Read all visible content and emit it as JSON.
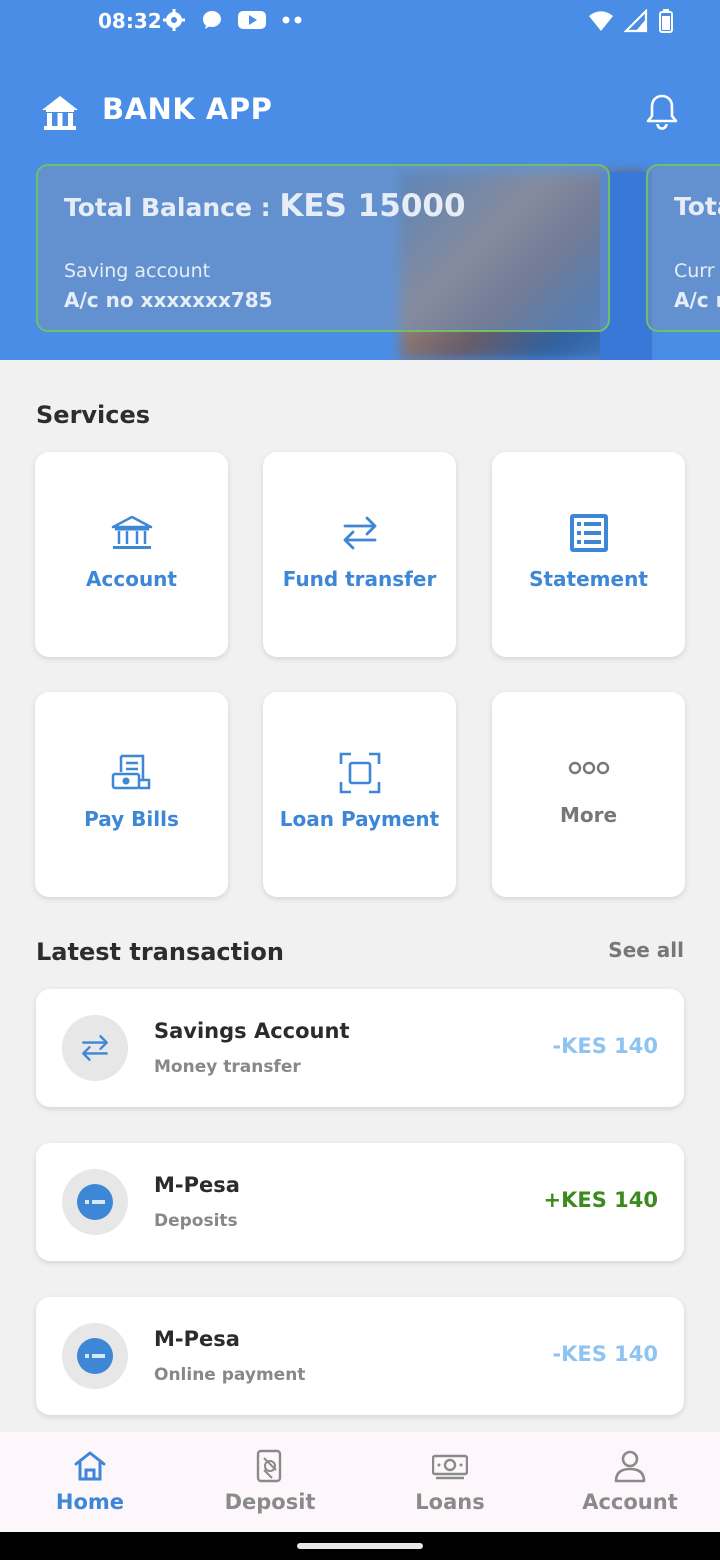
{
  "status_bar": {
    "time": "08:32",
    "icons": [
      "gear-icon",
      "chat-icon",
      "youtube-icon",
      "dots-icon",
      "wifi-icon",
      "signal-icon",
      "battery-icon"
    ]
  },
  "app_bar": {
    "title": "BANK APP",
    "logo_icon": "bank-home-icon",
    "bell_icon": "bell-icon"
  },
  "balance_cards": [
    {
      "balance_label": "Total Balance : ",
      "balance_value": "KES 15000",
      "account_type": "Saving account",
      "account_no": "A/c no xxxxxxx785"
    },
    {
      "balance_label": "Tota",
      "account_type": "Curr",
      "account_no": "A/c n"
    }
  ],
  "services": {
    "title": "Services",
    "items": [
      {
        "label": "Account",
        "icon": "bank-icon"
      },
      {
        "label": "Fund transfer",
        "icon": "transfer-icon"
      },
      {
        "label": "Statement",
        "icon": "statement-icon"
      },
      {
        "label": "Pay Bills",
        "icon": "bill-icon"
      },
      {
        "label": "Loan Payment",
        "icon": "scan-icon"
      },
      {
        "label": "More",
        "icon": "more-icon"
      }
    ]
  },
  "transactions": {
    "title": "Latest transaction",
    "see_all": "See all",
    "items": [
      {
        "title": "Savings Account",
        "subtitle": "Money transfer",
        "amount": "-KES 140",
        "icon": "transfer-icon"
      },
      {
        "title": "M-Pesa",
        "subtitle": "Deposits",
        "amount": "+KES 140",
        "icon": "mpesa-icon"
      },
      {
        "title": "M-Pesa",
        "subtitle": "Online payment",
        "amount": "-KES 140",
        "icon": "mpesa-icon"
      }
    ]
  },
  "bottom_nav": {
    "items": [
      {
        "label": "Home",
        "icon": "home-icon",
        "active": true
      },
      {
        "label": "Deposit",
        "icon": "deposit-icon",
        "active": false
      },
      {
        "label": "Loans",
        "icon": "cash-icon",
        "active": false
      },
      {
        "label": "Account",
        "icon": "person-icon",
        "active": false
      }
    ]
  },
  "colors": {
    "header_blue": "#4a8de6",
    "accent_blue": "#3e86d6",
    "positive_green": "#3d8a1e",
    "negative_blue": "#8ec3f2"
  }
}
